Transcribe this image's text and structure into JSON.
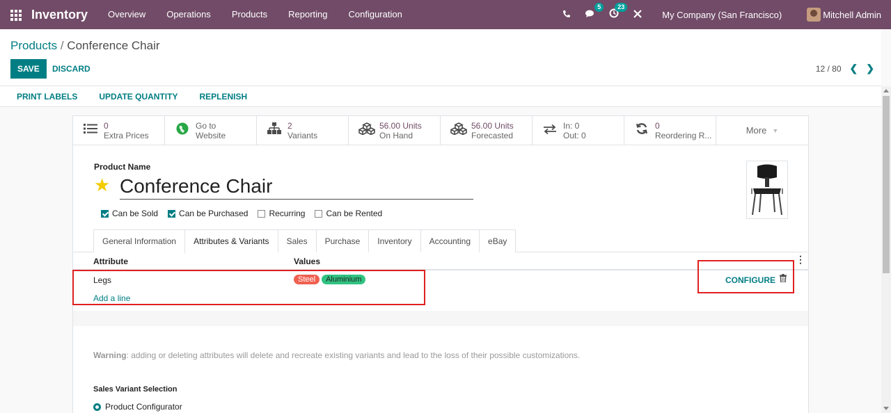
{
  "navbar": {
    "app_name": "Inventory",
    "menu": [
      "Overview",
      "Operations",
      "Products",
      "Reporting",
      "Configuration"
    ],
    "messages_badge": "5",
    "activity_badge": "23",
    "company": "My Company (San Francisco)",
    "user": "Mitchell Admin"
  },
  "breadcrumb": {
    "parent": "Products",
    "separator": "/",
    "current": "Conference Chair"
  },
  "actions": {
    "save": "SAVE",
    "discard": "DISCARD"
  },
  "pager": {
    "text": "12 / 80"
  },
  "statusbar": {
    "buttons": [
      "PRINT LABELS",
      "UPDATE QUANTITY",
      "REPLENISH"
    ]
  },
  "smart_buttons": [
    {
      "value": "0",
      "label": "Extra Prices",
      "icon": "list-icon"
    },
    {
      "value": "Go to",
      "label": "Website",
      "icon": "globe-icon"
    },
    {
      "value": "2",
      "label": "Variants",
      "icon": "sitemap-icon"
    },
    {
      "value": "56.00 Units",
      "label": "On Hand",
      "icon": "cubes-icon"
    },
    {
      "value": "56.00 Units",
      "label": "Forecasted",
      "icon": "cubes-icon"
    },
    {
      "value": "In:  0",
      "label": "Out:  0",
      "icon": "exchange-icon"
    },
    {
      "value": "0",
      "label": "Reordering R...",
      "icon": "refresh-icon"
    }
  ],
  "more_label": "More",
  "form": {
    "name_label": "Product Name",
    "name": "Conference Chair",
    "checkboxes": [
      {
        "label": "Can be Sold",
        "checked": true
      },
      {
        "label": "Can be Purchased",
        "checked": true
      },
      {
        "label": "Recurring",
        "checked": false
      },
      {
        "label": "Can be Rented",
        "checked": false
      }
    ],
    "tabs": [
      "General Information",
      "Attributes & Variants",
      "Sales",
      "Purchase",
      "Inventory",
      "Accounting",
      "eBay"
    ],
    "active_tab": "Attributes & Variants"
  },
  "attributes_table": {
    "headers": {
      "attribute": "Attribute",
      "values": "Values"
    },
    "rows": [
      {
        "attribute": "Legs",
        "values": [
          "Steel",
          "Aluminium"
        ]
      }
    ],
    "configure_label": "CONFIGURE",
    "add_line": "Add a line"
  },
  "warning": {
    "prefix": "Warning",
    "text": ": adding or deleting attributes will delete and recreate existing variants and lead to the loss of their possible customizations."
  },
  "sales_variant": {
    "label": "Sales Variant Selection",
    "option": "Product Configurator"
  },
  "colors": {
    "navbar": "#714b67",
    "primary": "#017e84",
    "annotation": "#e02020",
    "tag_steel": "#f06050",
    "tag_aluminium": "#30c381"
  }
}
